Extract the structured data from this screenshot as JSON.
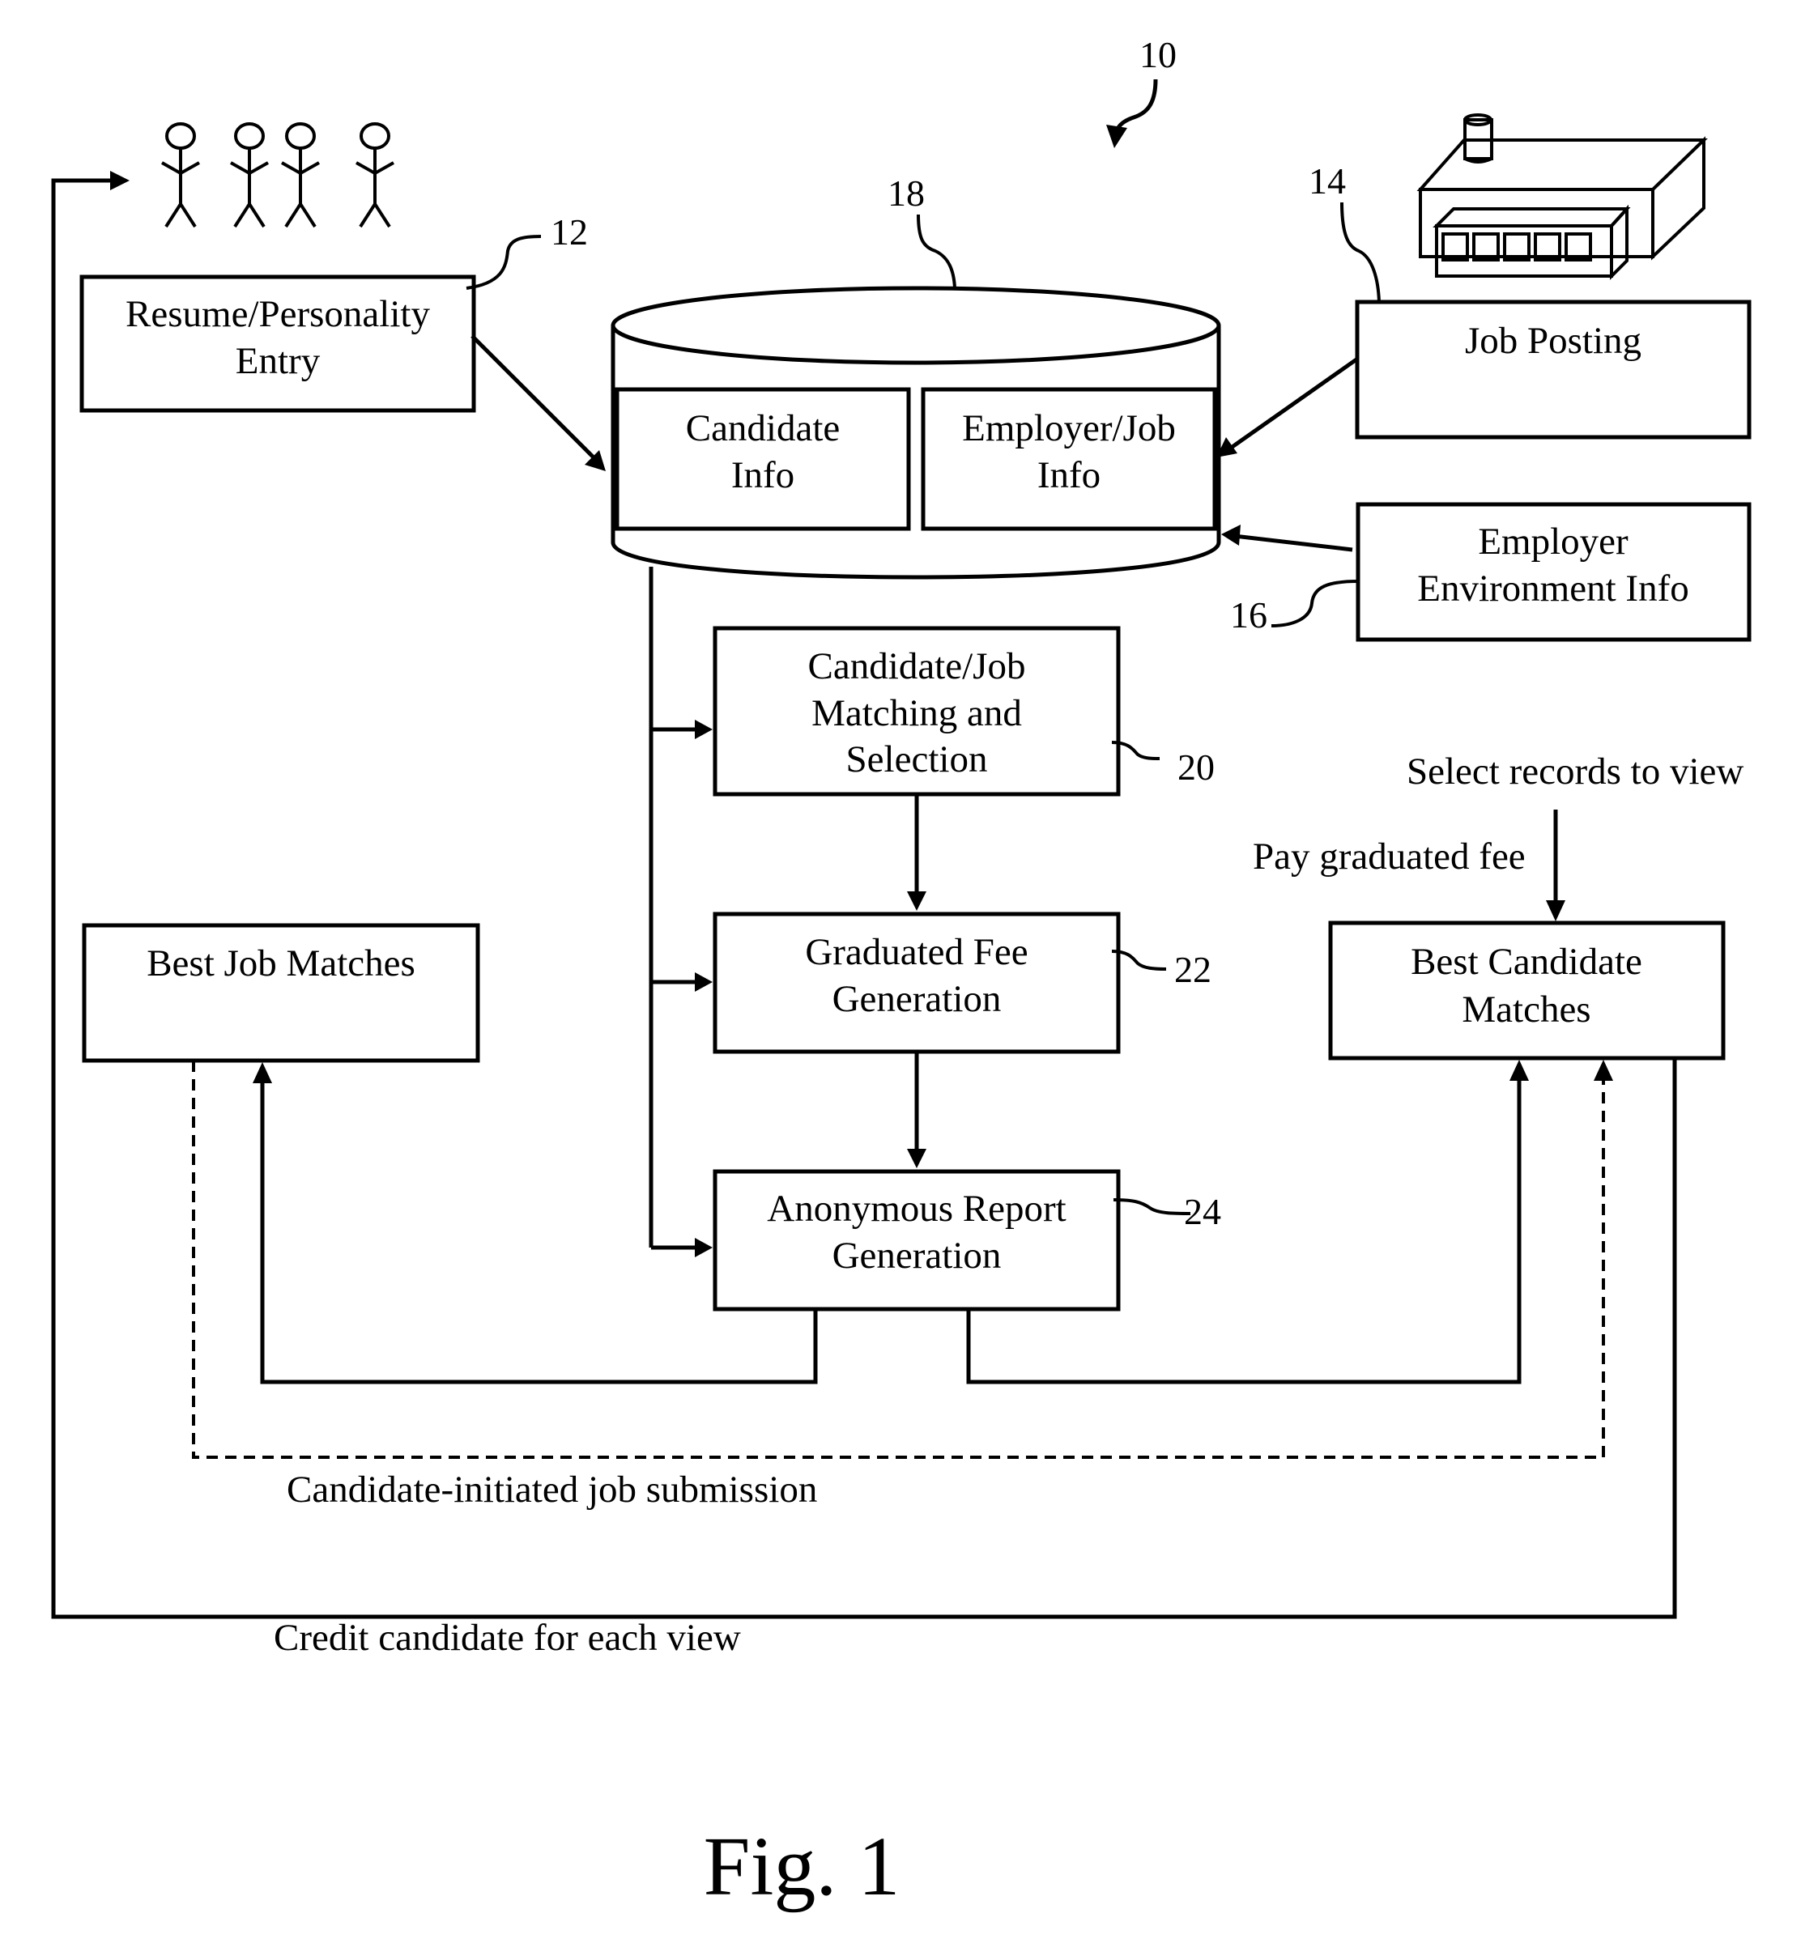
{
  "figure": {
    "title": "Fig. 1",
    "system_ref": "10"
  },
  "icons": {
    "people": "stick-figures-candidates",
    "factory": "factory-employer"
  },
  "nodes": {
    "resume_entry": {
      "ref": "12",
      "lines": [
        "Resume/Personality",
        "Entry"
      ]
    },
    "database": {
      "ref": "18"
    },
    "candidate_info": {
      "lines": [
        "Candidate",
        "Info"
      ]
    },
    "employer_job_info": {
      "lines": [
        "Employer/Job",
        "Info"
      ]
    },
    "job_posting": {
      "ref": "14",
      "lines": [
        "Job Posting"
      ]
    },
    "employer_env": {
      "ref": "16",
      "lines": [
        "Employer",
        "Environment Info"
      ]
    },
    "matching": {
      "ref": "20",
      "lines": [
        "Candidate/Job",
        "Matching and",
        "Selection"
      ]
    },
    "fee_generation": {
      "ref": "22",
      "lines": [
        "Graduated Fee",
        "Generation"
      ]
    },
    "report_generation": {
      "ref": "24",
      "lines": [
        "Anonymous Report",
        "Generation"
      ]
    },
    "best_job_matches": {
      "lines": [
        "Best Job Matches"
      ]
    },
    "best_candidate_matches": {
      "lines": [
        "Best Candidate",
        "Matches"
      ]
    }
  },
  "edge_labels": {
    "select_records": "Select records to view",
    "pay_fee": "Pay graduated fee",
    "candidate_submission": "Candidate-initiated job submission",
    "credit_candidate": "Credit candidate for each view"
  }
}
